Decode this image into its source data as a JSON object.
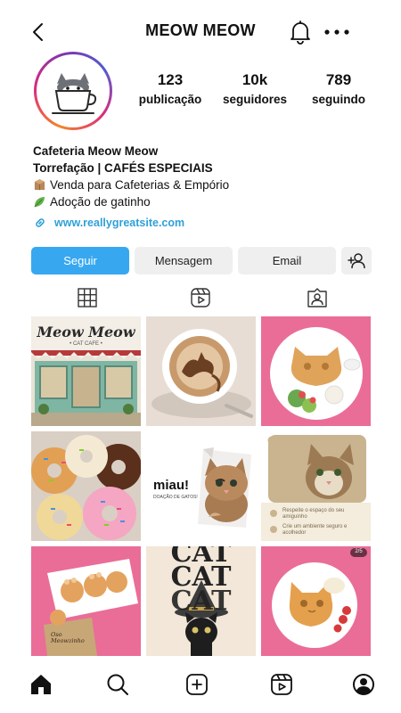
{
  "header": {
    "title": "MEOW MEOW"
  },
  "profile": {
    "stats": {
      "posts": {
        "value": "123",
        "label": "publicação"
      },
      "followers": {
        "value": "10k",
        "label": "seguidores"
      },
      "following": {
        "value": "789",
        "label": "seguindo"
      }
    },
    "bio": {
      "name": "Cafeteria Meow Meow",
      "tagline": "Torrefação | CAFÉS ESPECIAIS",
      "line1": "Venda para Cafeterias & Empório",
      "line2": "Adoção de gatinho",
      "link": "www.reallygreatsite.com"
    }
  },
  "actions": {
    "follow": "Seguir",
    "message": "Mensagem",
    "email": "Email"
  },
  "posts": {
    "p0": {
      "sign": "Meow Meow",
      "sub": "• CAT CAFE •"
    },
    "p4": {
      "title": "miau!",
      "sub": "DOAÇÃO DE GATOS!"
    },
    "p5": {
      "tip1": "Respeite o espaço do seu amiguinho",
      "tip2": "Crie um ambiente seguro e acolhedor"
    },
    "p6": {
      "bag": "Oso Meowzinho"
    },
    "p7": {
      "w1": "CAT",
      "w2": "CAT",
      "w3": "CAT"
    },
    "p8": {
      "badge": "2/5"
    }
  },
  "icons": {
    "top": [
      "back-icon",
      "bell-icon",
      "more-icon"
    ],
    "tabs": [
      "grid-icon",
      "reels-icon",
      "tagged-icon"
    ],
    "nav": [
      "home-icon",
      "search-icon",
      "add-icon",
      "reels-icon",
      "profile-icon"
    ]
  },
  "colors": {
    "follow_button": "#37a8f0",
    "link": "#2fa0d8",
    "secondary_button": "#efefef"
  }
}
